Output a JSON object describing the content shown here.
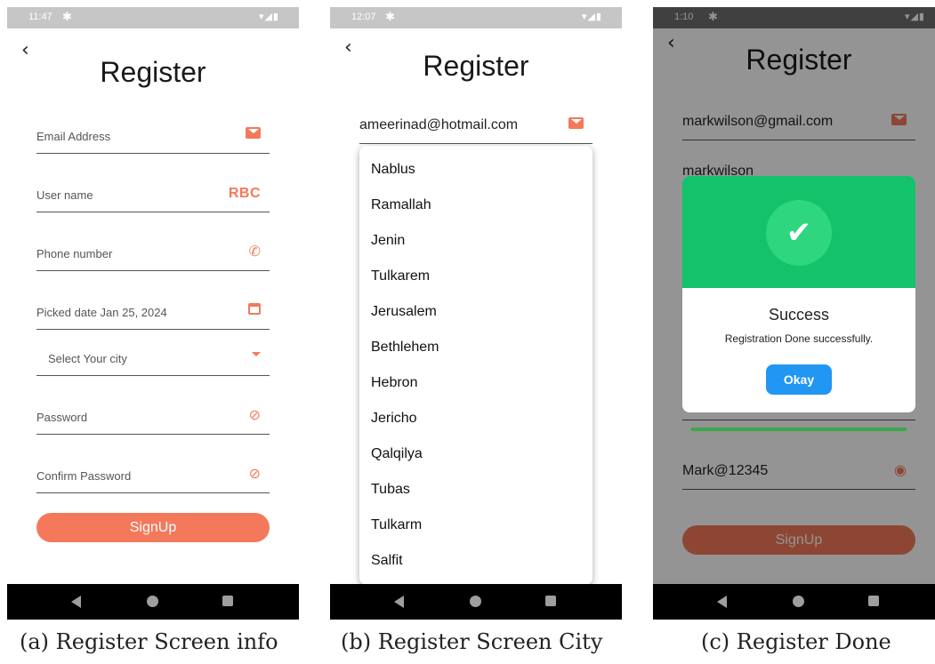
{
  "panel1": {
    "status_time": "11:47",
    "title": "Register",
    "fields": {
      "email": "Email Address",
      "username": "User name",
      "phone": "Phone number",
      "date": "Picked date Jan 25, 2024",
      "city": "Select Your city",
      "password": "Password",
      "confirm": "Confirm Password"
    },
    "abc_icon": "RBC",
    "signup": "SignUp",
    "caption": "(a) Register Screen info"
  },
  "panel2": {
    "status_time": "12:07",
    "title": "Register",
    "email_value": "ameerinad@hotmail.com",
    "cities": [
      "Nablus",
      "Ramallah",
      "Jenin",
      "Tulkarem",
      "Jerusalem",
      "Bethlehem",
      "Hebron",
      "Jericho",
      "Qalqilya",
      "Tubas",
      "Tulkarm",
      "Salfit"
    ],
    "caption": "(b) Register Screen City"
  },
  "panel3": {
    "status_time": "1:10",
    "title": "Register",
    "email_value": "markwilson@gmail.com",
    "username_value_partial": "markwilson",
    "password_value": "Mark@12345",
    "signup": "SignUp",
    "dialog": {
      "title": "Success",
      "message": "Registration Done successfully.",
      "button": "Okay"
    },
    "caption": "(c) Register Done"
  },
  "colors": {
    "accent": "#f4795b",
    "success": "#14c26b",
    "okay_button": "#2196f3"
  },
  "icons": [
    "mail-icon",
    "abc-icon",
    "phone-icon",
    "calendar-icon",
    "dropdown-caret-icon",
    "eye-off-icon",
    "eye-icon",
    "check-icon",
    "back-arrow-icon"
  ]
}
